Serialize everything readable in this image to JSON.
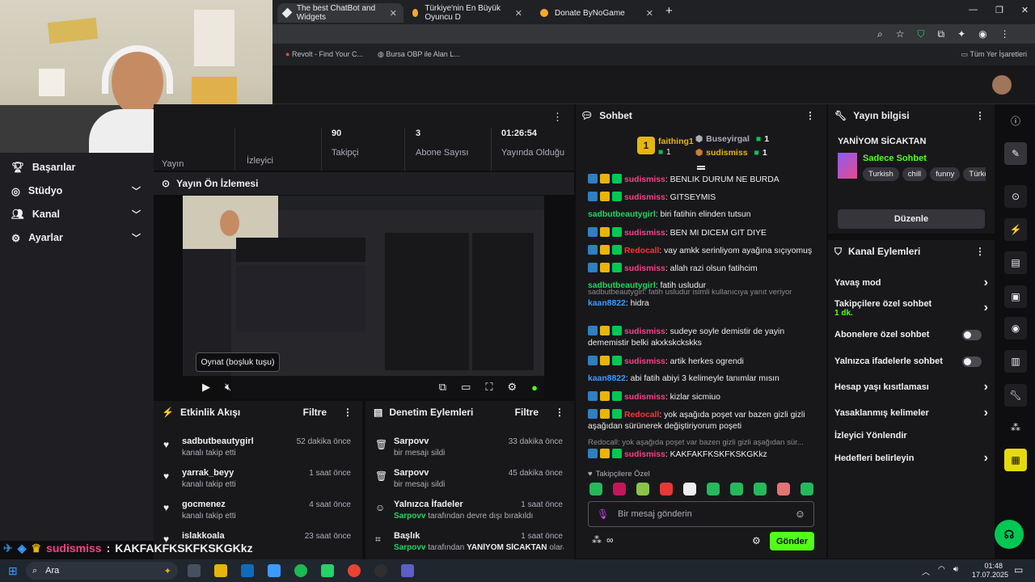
{
  "browser": {
    "tabs": [
      {
        "label": "The best ChatBot and Widgets"
      },
      {
        "label": "Türkiye'nin En Büyük Oyuncu D"
      },
      {
        "label": "Donate ByNoGame"
      }
    ],
    "new_tab": "+",
    "bookmarks": [
      {
        "label": "Revolt - Find Your C..."
      },
      {
        "label": "Bursa OBP ile Alan L..."
      }
    ],
    "all_bookmarks": "Tüm Yer İşaretleri"
  },
  "sidebar": {
    "items": [
      {
        "label": "Başarılar",
        "has_chevron": false
      },
      {
        "label": "Stüdyo",
        "has_chevron": true
      },
      {
        "label": "Kanal",
        "has_chevron": true
      },
      {
        "label": "Ayarlar",
        "has_chevron": true
      }
    ]
  },
  "stats": {
    "col1_label": "Yayın",
    "col2_label": "İzleyici",
    "followers": {
      "value": "90",
      "label": "Takipçi"
    },
    "subs": {
      "value": "3",
      "label": "Abone Sayısı"
    },
    "uptime": {
      "value": "01:26:54",
      "label": "Yayında Olduğu"
    }
  },
  "preview": {
    "title": "Yayın Ön İzlemesi",
    "tooltip": "Oynat (boşluk tuşu)"
  },
  "activity": {
    "title": "Etkinlik Akışı",
    "filter": "Filtre",
    "rows": [
      {
        "user": "sadbutbeautygirl",
        "action": "kanalı takip etti",
        "time": "52 dakika önce"
      },
      {
        "user": "yarrak_beyy",
        "action": "kanalı takip etti",
        "time": "1 saat önce"
      },
      {
        "user": "gocmenez",
        "action": "kanalı takip etti",
        "time": "4 saat önce"
      },
      {
        "user": "islakkoala",
        "action": "",
        "time": "23 saat önce"
      }
    ]
  },
  "moderation": {
    "title": "Denetim Eylemleri",
    "filter": "Filtre",
    "rows": [
      {
        "title": "Sarpovv",
        "desc": "bir mesajı sildi",
        "time": "33 dakika önce",
        "icon": "trash-icon"
      },
      {
        "title": "Sarpovv",
        "desc": "bir mesajı sildi",
        "time": "45 dakika önce",
        "icon": "trash-icon"
      },
      {
        "title": "Yalnızca İfadeler",
        "desc_user": "Sarpovv",
        "desc": "tarafından devre dışı bırakıldı",
        "time": "1 saat önce",
        "icon": "emoji-icon"
      },
      {
        "title": "Başlık",
        "desc_user": "Sarpovv",
        "desc": "tarafından",
        "desc_tail": "YANİYOM SİCAKTAN",
        "desc_end": "olarak",
        "time": "1 saat önce",
        "icon": "title-icon"
      }
    ]
  },
  "chat": {
    "title": "Sohbet",
    "leaderboard": [
      {
        "rank": "1",
        "name": "faithing1",
        "count": "1"
      },
      {
        "name": "Buseyirgal",
        "count": "1"
      },
      {
        "name": "sudismiss",
        "count": "1"
      }
    ],
    "messages": [
      {
        "user": "sudismiss",
        "color": "#ff3d8b",
        "text": "BENLIK DURUM NE BURDA",
        "badges": true
      },
      {
        "user": "sudismiss",
        "color": "#ff3d8b",
        "text": "GITSEYMIS",
        "badges": true
      },
      {
        "user": "sadbutbeautygirl",
        "color": "#1fd65f",
        "text": "biri fatihin elinden tutsun",
        "badges": false
      },
      {
        "user": "sudismiss",
        "color": "#ff3d8b",
        "text": "BEN MI DICEM GIT DIYE",
        "badges": true
      },
      {
        "user": "Redocall",
        "color": "#ff3333",
        "text": "vay amkk serinliyom ayağına sıçıyomuş",
        "badges": true
      },
      {
        "user": "sudismiss",
        "color": "#ff3d8b",
        "text": "allah razi olsun fatihcim",
        "badges": true
      },
      {
        "user": "sadbutbeautygirl",
        "color": "#1fd65f",
        "text": "fatih usludur",
        "badges": false
      },
      {
        "reply": "sadbutbeautygirl: fatih usludur isimli kullanıcıya yanıt veriyor",
        "user": "kaan8822",
        "color": "#3d9bff",
        "text": "hidra",
        "badges": false
      },
      {
        "user": "sudismiss",
        "color": "#ff3d8b",
        "text": "sudeye soyle demistir de yayin dememistir belki akxkskckskks",
        "badges": true
      },
      {
        "user": "sudismiss",
        "color": "#ff3d8b",
        "text": "artik herkes ogrendi",
        "badges": true
      },
      {
        "user": "kaan8822",
        "color": "#3d9bff",
        "text": "abi fatih abiyi 3 kelimeyle tanımlar mısın",
        "badges": false
      },
      {
        "user": "sudismiss",
        "color": "#ff3d8b",
        "text": "kizlar sicmiuo",
        "badges": true
      },
      {
        "user": "Redocall",
        "color": "#ff3333",
        "text": "yok aşağıda poşet var bazen gizli gizli aşağıdan sürünerek değiştiriyorum poşeti",
        "badges": true
      },
      {
        "reply": "Redocall: yok aşağıda poşet var bazen gizli gizli aşağıdan sür...",
        "user": "sudismiss",
        "color": "#ff3d8b",
        "text": "KAKFAKFKSKFKSKGKkz",
        "badges": true
      }
    ],
    "followers_only": "Takipçilere Özel",
    "input_placeholder": "Bir mesaj gönderin",
    "infinity": "∞",
    "send": "Gönder"
  },
  "stream_info": {
    "title": "Yayın bilgisi",
    "stream_title": "YANİYOM SİCAKTAN",
    "category": "Sadece Sohbet",
    "tags": [
      "Turkish",
      "chill",
      "funny",
      "Türkç"
    ],
    "edit": "Düzenle"
  },
  "channel_actions": {
    "title": "Kanal Eylemleri",
    "items": [
      {
        "label": "Yavaş mod",
        "kind": "chevron"
      },
      {
        "label": "Takipçilere özel sohbet",
        "sub": "1 dk.",
        "kind": "chevron"
      },
      {
        "label": "Abonelere özel sohbet",
        "kind": "toggle"
      },
      {
        "label": "Yalnızca ifadelerle sohbet",
        "kind": "toggle"
      },
      {
        "label": "Hesap yaşı kısıtlaması",
        "kind": "chevron"
      },
      {
        "label": "Yasaklanmış kelimeler",
        "kind": "chevron"
      },
      {
        "label": "İzleyici Yönlendir",
        "kind": "none"
      },
      {
        "label": "Hedefleri belirleyin",
        "kind": "chevron"
      }
    ]
  },
  "overlay": {
    "user": "sudismiss",
    "separator": ":",
    "text": "KAKFAKFKSKFKSKGKkz"
  },
  "taskbar": {
    "search": "Ara",
    "time": "01:48",
    "date": "17.07.2025"
  },
  "colors": {
    "accent_green": "#53fc18",
    "bg": "#0e0e10",
    "panel": "#18181b"
  }
}
